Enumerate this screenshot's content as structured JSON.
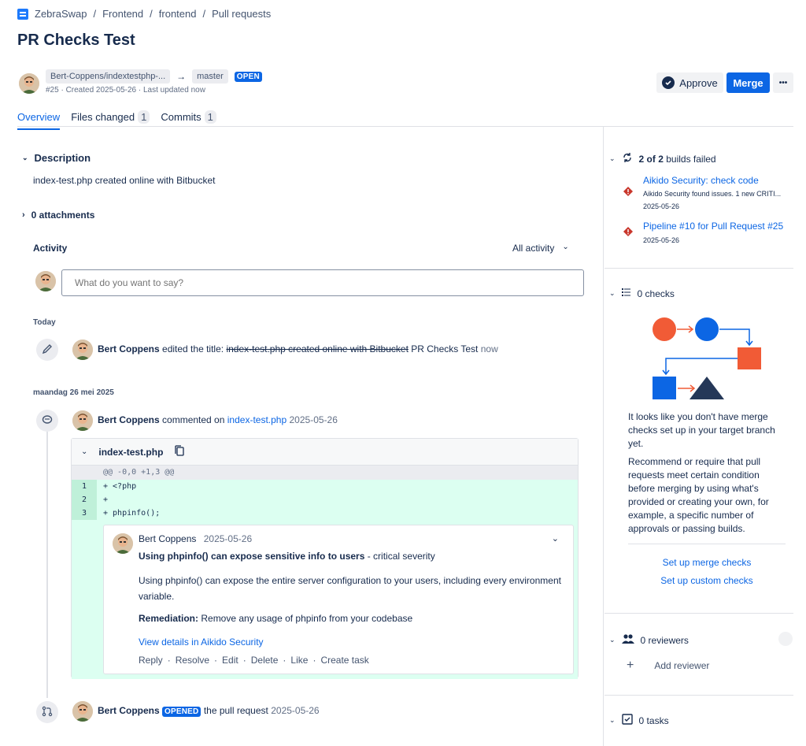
{
  "breadcrumb": {
    "workspace": "ZebraSwap",
    "sep": "/",
    "project": "Frontend",
    "repo": "frontend",
    "section": "Pull requests"
  },
  "pr": {
    "title": "PR Checks Test",
    "source_branch": "Bert-Coppens/indextestphp-...",
    "arrow": "→",
    "target_branch": "master",
    "status": "OPEN",
    "meta": "#25 · Created 2025-05-26 · Last updated now"
  },
  "actions": {
    "approve": "Approve",
    "merge": "Merge",
    "more": "•••"
  },
  "tabs": [
    {
      "label": "Overview",
      "count": ""
    },
    {
      "label": "Files changed",
      "count": "1"
    },
    {
      "label": "Commits",
      "count": "1"
    }
  ],
  "description": {
    "heading": "Description",
    "text": "index-test.php created online with Bitbucket"
  },
  "attachments": {
    "label": "0 attachments"
  },
  "activity": {
    "heading": "Activity",
    "filter": "All activity",
    "comment_placeholder": "What do you want to say?",
    "today_label": "Today",
    "edit_event": {
      "author": "Bert Coppens",
      "verb": "edited the title:",
      "old_title": "index-test.php created online with Bitbucket",
      "new_title": "PR Checks Test",
      "time": "now"
    },
    "date_label": "maandag 26 mei 2025",
    "comment_event": {
      "author": "Bert Coppens",
      "verb": "commented on",
      "file": "index-test.php",
      "date": "2025-05-26"
    },
    "open_event": {
      "author": "Bert Coppens",
      "badge": "OPENED",
      "text": "the pull request",
      "date": "2025-05-26"
    }
  },
  "file_card": {
    "filename": "index-test.php",
    "hunk": "@@ -0,0 +1,3 @@",
    "lines": [
      {
        "num": "1",
        "code": "+ <?php"
      },
      {
        "num": "2",
        "code": "+"
      },
      {
        "num": "3",
        "code": "+ phpinfo();"
      }
    ]
  },
  "inline_comment": {
    "author": "Bert Coppens",
    "date": "2025-05-26",
    "title_bold": "Using phpinfo() can expose sensitive info to users",
    "title_rest": " - critical severity",
    "body": "Using phpinfo() can expose the entire server configuration to your users, including every environment variable.",
    "remediation_label": "Remediation:",
    "remediation_text": " Remove any usage of phpinfo from your codebase",
    "link": "View details in Aikido Security",
    "footer": [
      "Reply",
      "Resolve",
      "Edit",
      "Delete",
      "Like",
      "Create task"
    ]
  },
  "sidebar": {
    "builds": {
      "summary_bold": "2 of 2",
      "summary_rest": " builds failed",
      "items": [
        {
          "title": "Aikido Security: check code",
          "desc": "Aikido Security found issues. 1 new CRITI...",
          "date": "2025-05-26"
        },
        {
          "title": "Pipeline #10 for Pull Request #25",
          "desc": "",
          "date": "2025-05-26"
        }
      ]
    },
    "checks": {
      "heading": "0 checks",
      "text1": "It looks like you don't have merge checks set up in your target branch yet.",
      "text2": "Recommend or require that pull requests meet certain condition before merging by using what's provided or creating your own, for example, a specific number of approvals or passing builds.",
      "link1": "Set up merge checks",
      "link2": "Set up custom checks"
    },
    "reviewers": {
      "heading": "0 reviewers",
      "add": "Add reviewer"
    },
    "tasks": {
      "heading": "0 tasks"
    }
  },
  "colors": {
    "accent": "#0c66e4",
    "error": "#c9372c",
    "orange": "#f15b36",
    "navy": "#253858",
    "added": "#dcfff1"
  }
}
